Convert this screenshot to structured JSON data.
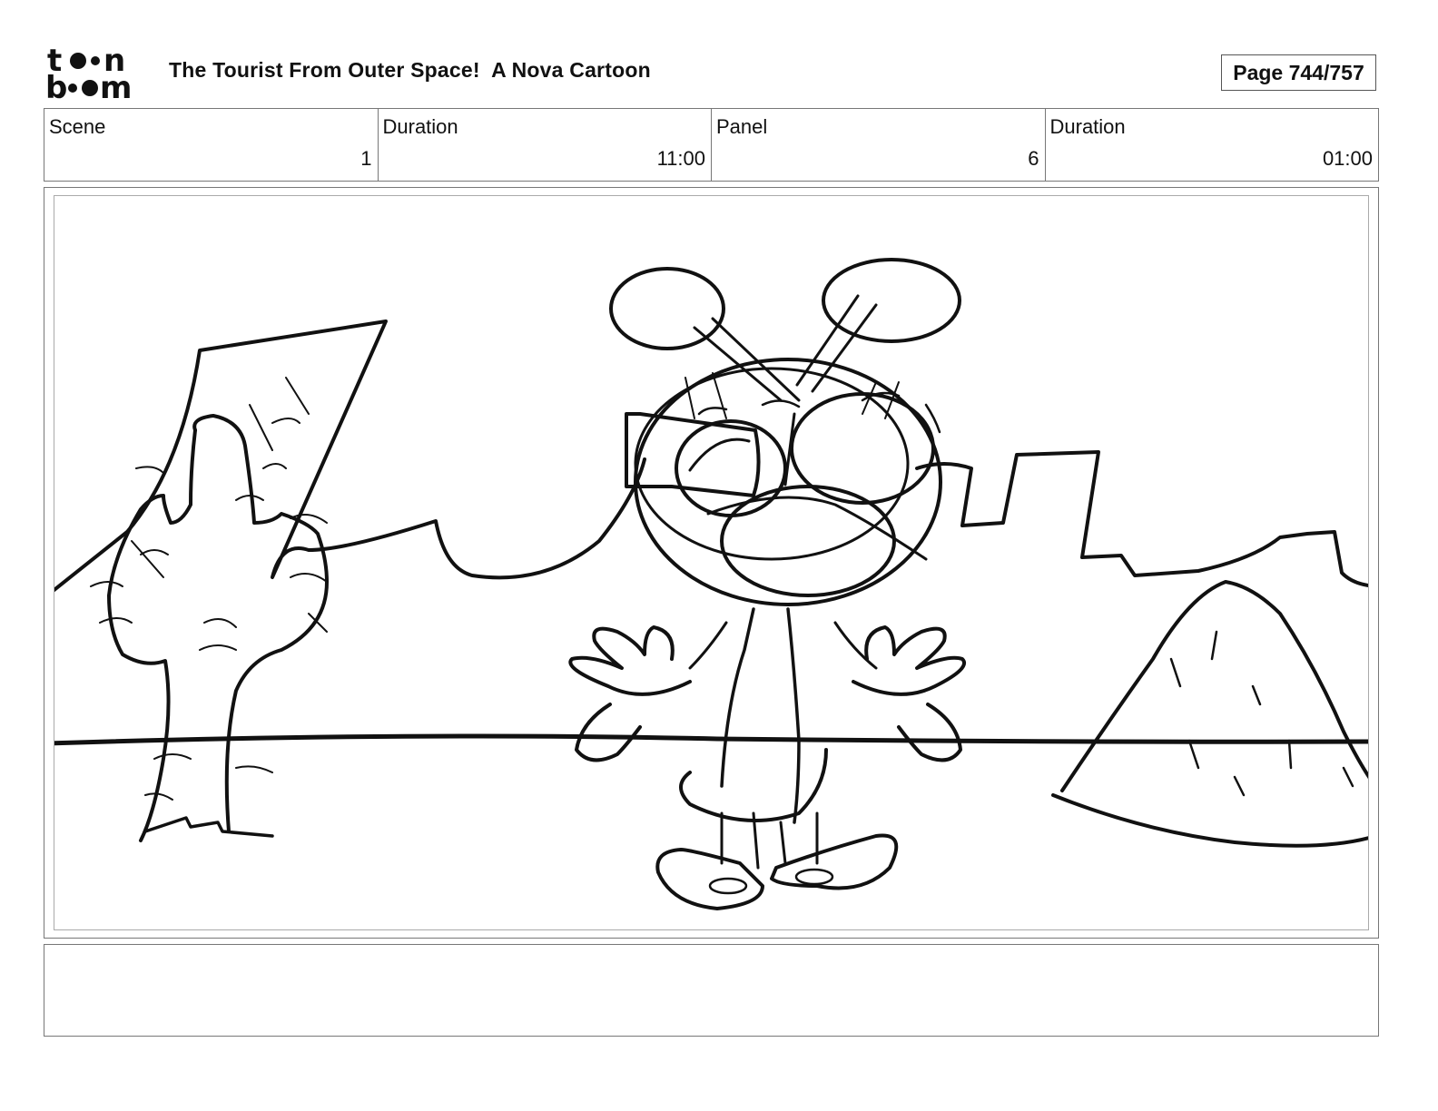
{
  "header": {
    "logo_text": "toon boom",
    "title": "The Tourist From Outer Space!  A Nova Cartoon",
    "page": "Page 744/757"
  },
  "info": {
    "scene_label": "Scene",
    "scene_value": "1",
    "scene_duration_label": "Duration",
    "scene_duration_value": "11:00",
    "panel_label": "Panel",
    "panel_value": "6",
    "panel_duration_label": "Duration",
    "panel_duration_value": "01:00"
  },
  "panel": {
    "drawing": "alien-cactus-desert-sketch-icon"
  }
}
